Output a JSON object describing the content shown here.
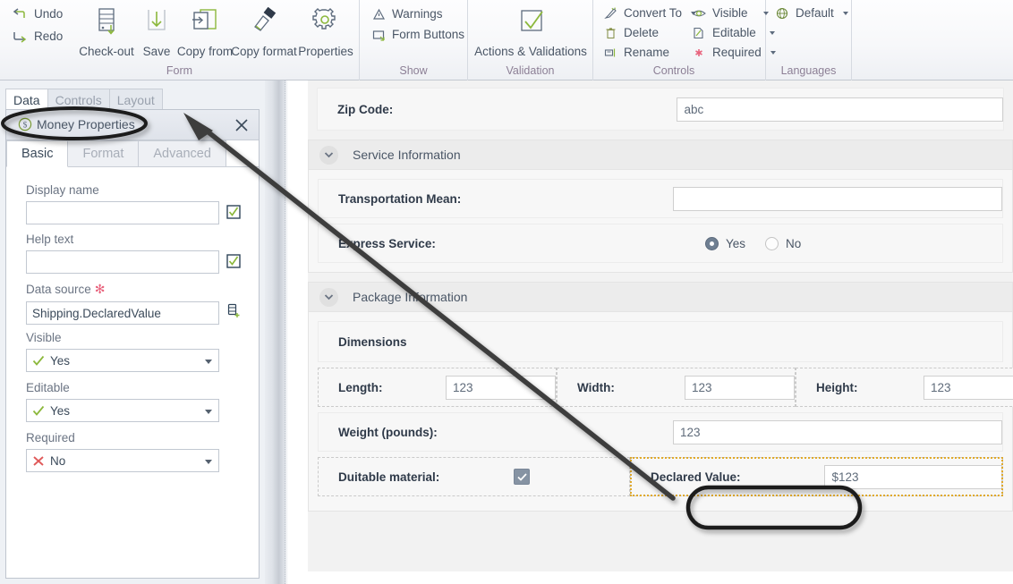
{
  "ribbon": {
    "groups": [
      {
        "name": "Form",
        "label": "Form",
        "small_buttons": [
          {
            "label": "Undo",
            "icon": "undo-icon"
          },
          {
            "label": "Redo",
            "icon": "redo-icon"
          }
        ],
        "big_buttons": [
          {
            "label": "Check-out",
            "icon": "check-out-icon"
          },
          {
            "label": "Save",
            "icon": "save-icon"
          },
          {
            "label": "Copy from",
            "icon": "copy-from-icon"
          },
          {
            "label": "Copy format",
            "icon": "copy-format-icon"
          },
          {
            "label": "Properties",
            "icon": "gear-icon"
          }
        ]
      },
      {
        "name": "Show",
        "label": "Show",
        "small_buttons": [
          {
            "label": "Warnings",
            "icon": "warning-triangle-icon"
          },
          {
            "label": "Form Buttons",
            "icon": "form-buttons-icon"
          }
        ]
      },
      {
        "name": "Validation",
        "label": "Validation",
        "big_buttons": [
          {
            "label": "Actions & Validations",
            "icon": "checkmark-box-icon"
          }
        ]
      },
      {
        "name": "Controls",
        "label": "Controls",
        "small_buttons": [
          {
            "label": "Convert To",
            "icon": "convert-to-icon",
            "dropdown": true
          },
          {
            "label": "Delete",
            "icon": "trash-icon"
          },
          {
            "label": "Rename",
            "icon": "rename-icon"
          },
          {
            "label": "Visible",
            "icon": "eye-icon",
            "dropdown": true
          },
          {
            "label": "Editable",
            "icon": "editable-page-icon",
            "dropdown": true
          },
          {
            "label": "Required",
            "icon": "asterisk-icon",
            "dropdown": true
          }
        ]
      },
      {
        "name": "Languages",
        "label": "Languages",
        "small_buttons": [
          {
            "label": "Default",
            "icon": "globe-icon",
            "dropdown": true
          }
        ]
      }
    ]
  },
  "left_panel": {
    "tabs": [
      {
        "label": "Data",
        "active": true
      },
      {
        "label": "Controls",
        "active": false
      },
      {
        "label": "Layout",
        "active": false
      }
    ],
    "dialog": {
      "title": "Money Properties",
      "title_icon": "money-coin-icon",
      "close_icon": "close-icon",
      "subtabs": [
        {
          "label": "Basic",
          "active": true
        },
        {
          "label": "Format",
          "active": false
        },
        {
          "label": "Advanced",
          "active": false
        }
      ],
      "fields": [
        {
          "label": "Display name",
          "type": "text",
          "value": "",
          "side_icon": "checkbox-green-check-icon",
          "required": false
        },
        {
          "label": "Help text",
          "type": "text",
          "value": "",
          "side_icon": "checkbox-green-check-icon",
          "required": false
        },
        {
          "label": "Data source",
          "type": "text",
          "value": "Shipping.DeclaredValue",
          "side_icon": "database-add-icon",
          "required": true,
          "required_marker": "✻"
        },
        {
          "label": "Visible",
          "type": "select",
          "value": "Yes",
          "state_icon": "green-check-icon"
        },
        {
          "label": "Editable",
          "type": "select",
          "value": "Yes",
          "state_icon": "green-check-icon"
        },
        {
          "label": "Required",
          "type": "select",
          "value": "No",
          "state_icon": "red-x-icon"
        }
      ]
    }
  },
  "form": {
    "top_row": {
      "label": "Zip Code:",
      "value": "abc"
    },
    "sections": [
      {
        "title": "Service Information",
        "chevron_icon": "chevron-down-icon",
        "rows": [
          {
            "label": "Transportation Mean:",
            "type": "text",
            "value": ""
          },
          {
            "label": "Express Service:",
            "type": "radio",
            "options": [
              {
                "label": "Yes",
                "selected": true
              },
              {
                "label": "No",
                "selected": false
              }
            ]
          }
        ]
      },
      {
        "title": "Package Information",
        "chevron_icon": "chevron-down-icon",
        "group_title": "Dimensions",
        "dimension_row": [
          {
            "label": "Length:",
            "value": "123"
          },
          {
            "label": "Width:",
            "value": "123"
          },
          {
            "label": "Height:",
            "value": "123"
          }
        ],
        "weight_row": {
          "label": "Weight (pounds):",
          "value": "123"
        },
        "bottom_row": [
          {
            "label": "Duitable material:",
            "type": "checkbox",
            "checked": true,
            "check_icon": "check-icon"
          },
          {
            "label": "Declared Value:",
            "type": "money",
            "value": "$123",
            "selected": true
          }
        ]
      }
    ]
  },
  "annotations": {
    "ellipse_title": "highlight-ellipse-money-properties",
    "ellipse_declared": "highlight-ellipse-declared-value",
    "arrow": "pointer-arrow"
  },
  "colors": {
    "accent_green": "#8cb83c",
    "label_purple": "#8c7f95",
    "selection_gold": "#e0a92b",
    "required_red": "#e8637d",
    "radio_fill": "#6f7f92"
  }
}
